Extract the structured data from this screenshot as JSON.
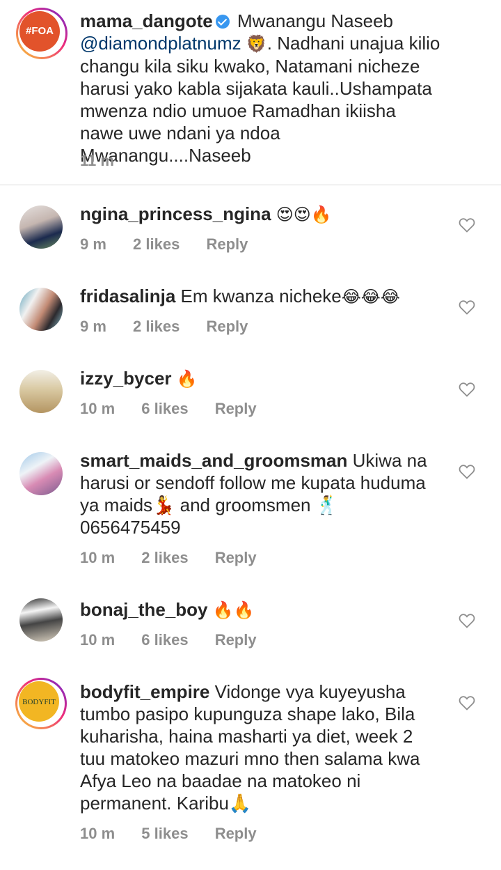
{
  "caption": {
    "username": "mama_dangote",
    "avatar_text": "#FOA",
    "text_before_mention": "Mwanangu Naseeb",
    "mention": "@diamondplatnumz",
    "emoji": "🦁",
    "text_after": ". Nadhani unajua kilio changu kila siku kwako, Natamani nicheze harusi yako kabla sijakata kauli..Ushampata mwenza ndio umuoe Ramadhan ikiisha nawe uwe ndani ya ndoa Mwanangu....Naseeb",
    "time": "11 m"
  },
  "comments": [
    {
      "username": "ngina_princess_ngina",
      "text": "",
      "emoji": "😍😍🔥",
      "time": "9 m",
      "likes": "2 likes",
      "reply": "Reply"
    },
    {
      "username": "fridasalinja",
      "text": "Em kwanza nicheke",
      "emoji": "😂😂😂",
      "time": "9 m",
      "likes": "2 likes",
      "reply": "Reply"
    },
    {
      "username": "izzy_bycer",
      "text": "",
      "emoji": "🔥",
      "time": "10 m",
      "likes": "6 likes",
      "reply": "Reply"
    },
    {
      "username": "smart_maids_and_groomsman",
      "text": "Ukiwa na harusi or sendoff follow me kupata huduma ya maids💃 and groomsmen 🕺 0656475459",
      "emoji": "",
      "time": "10 m",
      "likes": "2 likes",
      "reply": "Reply"
    },
    {
      "username": "bonaj_the_boy",
      "text": "",
      "emoji": "🔥🔥",
      "time": "10 m",
      "likes": "6 likes",
      "reply": "Reply"
    },
    {
      "username": "bodyfit_empire",
      "avatar_text": "BODYFIT",
      "text": "Vidonge vya kuyeyusha tumbo pasipo kupunguza shape lako, Bila kuharisha, haina masharti ya diet, week 2 tuu matokeo mazuri mno then salama kwa Afya Leo na baadae na matokeo ni permanent. Karibu🙏",
      "emoji": "",
      "time": "10 m",
      "likes": "5 likes",
      "reply": "Reply"
    }
  ],
  "colors": {
    "primary_text": "#262626",
    "secondary_text": "#8e8e8e",
    "mention": "#00376b",
    "verified": "#3897f0",
    "divider": "#dbdbdb"
  }
}
